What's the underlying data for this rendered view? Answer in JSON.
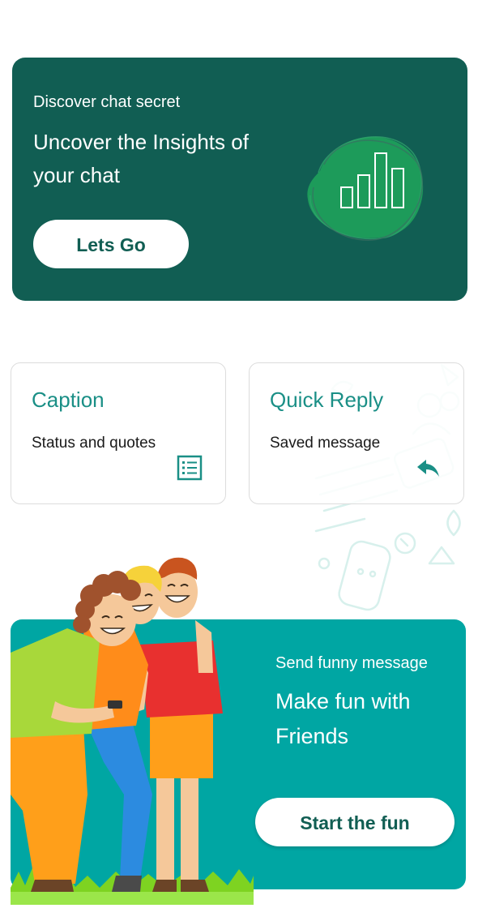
{
  "insights_card": {
    "subtitle": "Discover chat secret",
    "title": "Uncover the Insights of your chat",
    "button_label": "Lets Go",
    "icon": "bar-chart-icon",
    "background_color": "#115e53",
    "blob_color": "#1d9b5a"
  },
  "caption_card": {
    "title": "Caption",
    "subtitle": "Status and quotes",
    "icon": "list-icon"
  },
  "quick_reply_card": {
    "title": "Quick Reply",
    "subtitle": "Saved message",
    "icon": "reply-icon"
  },
  "fun_card": {
    "subtitle": "Send funny message",
    "title": "Make fun with Friends",
    "button_label": "Start the fun",
    "background_color": "#00a6a3",
    "illustration": "three-friends-laughing"
  },
  "colors": {
    "accent_teal": "#1a8f86",
    "dark_green": "#115e53"
  }
}
